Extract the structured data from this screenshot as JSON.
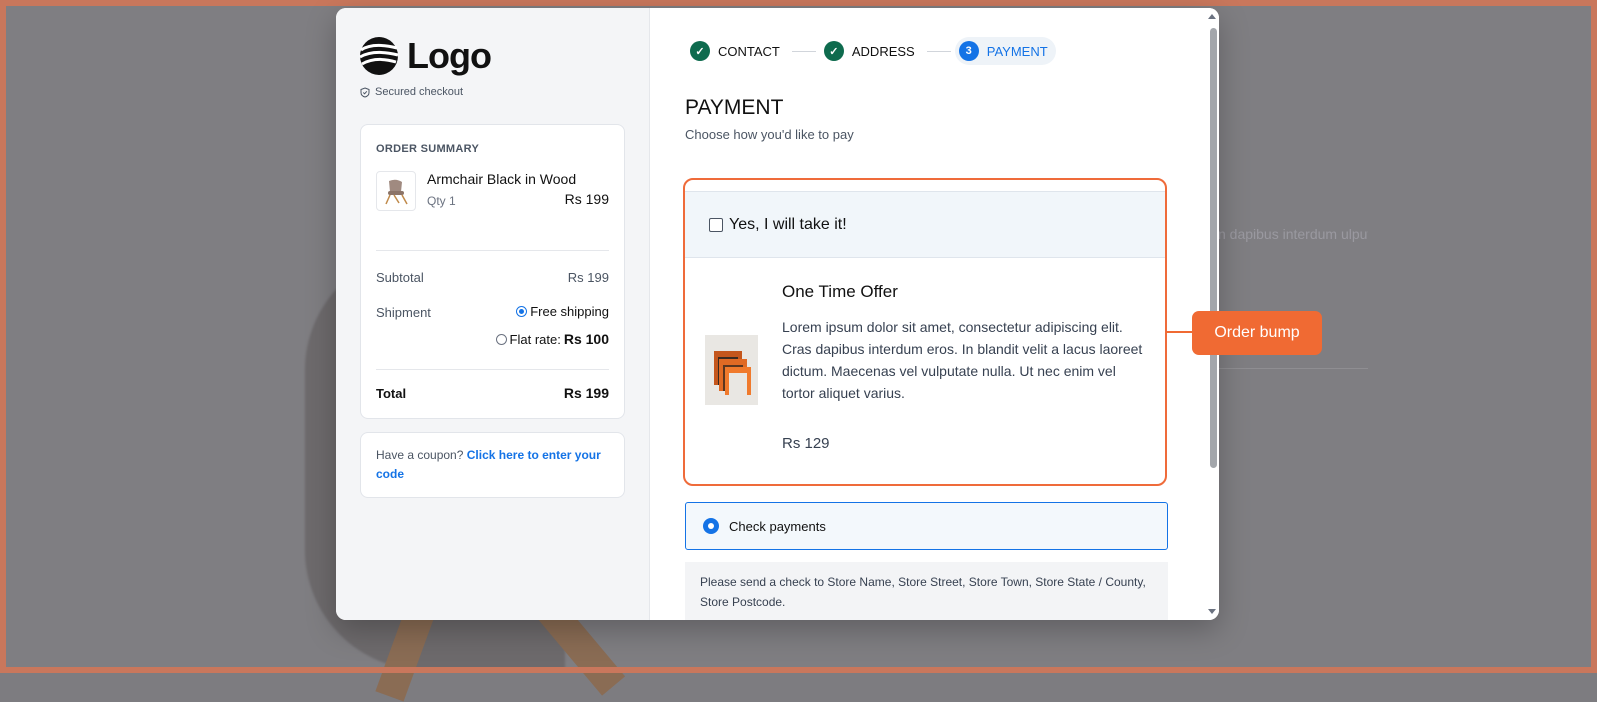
{
  "brand": {
    "logo_text": "Logo",
    "secured_label": "Secured checkout"
  },
  "steps": [
    {
      "label": "CONTACT",
      "state": "done",
      "icon": "check-icon"
    },
    {
      "label": "ADDRESS",
      "state": "done",
      "icon": "check-icon"
    },
    {
      "label": "PAYMENT",
      "state": "current",
      "number": "3"
    }
  ],
  "close_label": "×",
  "summary": {
    "title": "ORDER SUMMARY",
    "product_name": "Armchair Black in Wood",
    "product_qty": "Qty 1",
    "product_price": "Rs 199",
    "subtotal_label": "Subtotal",
    "subtotal_value": "Rs 199",
    "shipment_label": "Shipment",
    "free_shipping": "Free shipping",
    "flat_rate_label": "Flat rate:",
    "flat_rate_value": "Rs 100",
    "total_label": "Total",
    "total_value": "Rs 199"
  },
  "coupon": {
    "text": "Have a coupon?",
    "link": "Click here to enter your code"
  },
  "payment": {
    "title": "PAYMENT",
    "subtitle": "Choose how you'd like to pay"
  },
  "bump": {
    "checkbox_label": "Yes, I will take it!",
    "title": "One Time Offer",
    "description": "Lorem ipsum dolor sit amet, consectetur adipiscing elit. Cras dapibus interdum eros. In blandit velit a lacus laoreet dictum. Maecenas vel vulputate nulla. Ut nec enim vel tortor aliquet varius.",
    "price": "Rs 129"
  },
  "check_payments": {
    "label": "Check payments",
    "note": "Please send a check to Store Name, Store Street, Store Town, Store State / County, Store Postcode."
  },
  "callout": "Order bump",
  "background_text": "n dapibus interdum ulputate nulla. Ut nec",
  "colors": {
    "accent": "#1473e6",
    "callout": "#f06a33",
    "done_step": "#0e6b4e"
  }
}
